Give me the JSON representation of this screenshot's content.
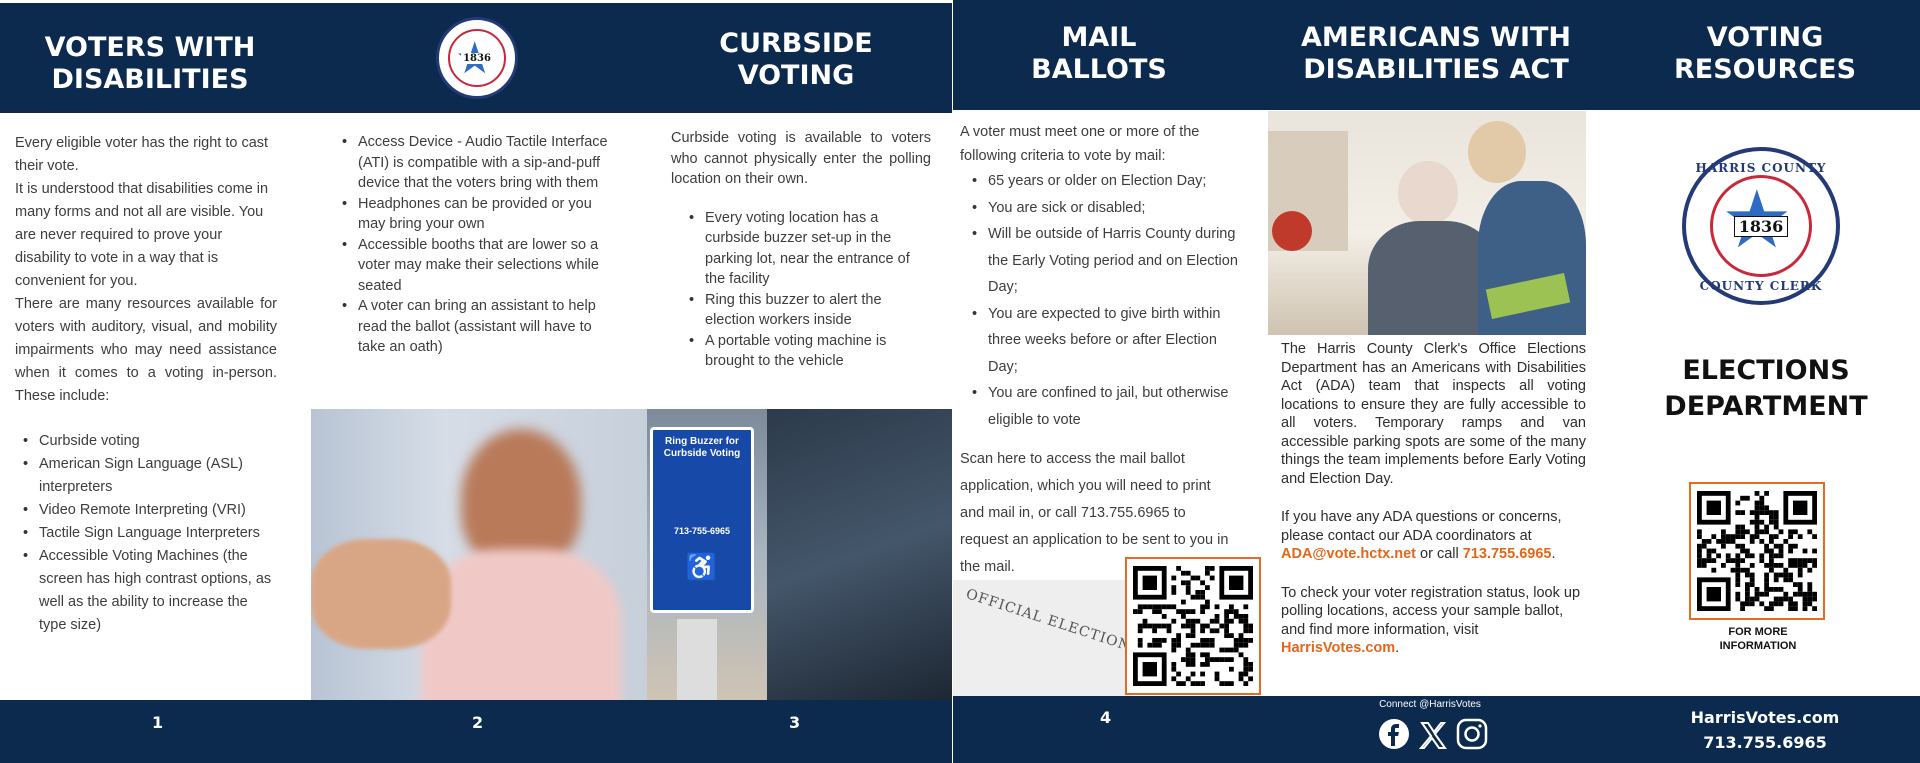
{
  "panels": {
    "voters_with_disabilities": {
      "title": "VOTERS WITH\nDISABILITIES",
      "para1": "Every eligible voter has the right to cast their vote.",
      "para2": "It is understood that disabilities come in many forms and not all are visible. You are never required to prove your disability to vote in a way that is convenient for you.",
      "para3": "There are many resources available for voters with auditory, visual, and mobility impairments who may need assistance when it comes to a voting in-person. These include:",
      "items": [
        "Curbside voting",
        "American Sign Language (ASL) interpreters",
        "Video Remote Interpreting (VRI)",
        "Tactile Sign Language Interpreters",
        "Accessible Voting Machines (the screen has high contrast options, as well as the ability to increase the type size)"
      ],
      "page": "1"
    },
    "accessibility_devices": {
      "seal_top": "HARRIS COUNTY",
      "seal_year": "1836",
      "seal_bottom": "COUNTY CLERK",
      "items": [
        "Access Device - Audio Tactile Interface (ATI) is compatible with a sip-and-puff device that the voters bring with them",
        "Headphones can be provided or you may bring your own",
        "Accessible booths that are lower so a voter may make their selections while seated",
        "A voter can bring an assistant to help read the ballot (assistant will have to take an oath)"
      ],
      "page": "2"
    },
    "curbside_voting": {
      "title": "CURBSIDE\nVOTING",
      "intro": "Curbside voting is available to voters who cannot physically enter the polling location on their own.",
      "items": [
        "Every voting location has a curbside buzzer set-up in the parking lot, near the entrance of the facility",
        "Ring this buzzer to alert the election workers inside",
        "A portable voting machine is brought to the vehicle"
      ],
      "sign_title": "Ring Buzzer for Curbside Voting",
      "sign_phone": "713-755-6965",
      "page": "3"
    },
    "mail_ballots": {
      "title": "MAIL\nBALLOTS",
      "intro": "A voter must meet one or more of the following criteria to vote by mail:",
      "items": [
        "65 years or older on Election Day;",
        "You are sick or disabled;",
        "Will be outside of Harris County during the Early Voting period and on Election Day;",
        "You are expected to give birth within three weeks before or after Election Day;",
        "You are confined to jail, but otherwise eligible to vote"
      ],
      "scan_text": "Scan here to access the mail ballot application, which you will need to print and mail in, or call 713.755.6965 to request an application to be sent to you in the mail.",
      "envelope_text": "OFFICIAL ELECTION MAIL",
      "page": "4"
    },
    "ada": {
      "title": "AMERICANS WITH\nDISABILITIES ACT",
      "para1": "The Harris County Clerk's Office Elections Department has an Americans with Disabilities Act (ADA) team that inspects all voting locations to ensure they are fully accessible to all voters. Temporary ramps and van accessible parking spots are some of the many things the team implements before Early Voting and Election Day.",
      "para2_a": "If you have any ADA questions or concerns, please contact our ADA coordinators at ",
      "para2_email": "ADA@vote.hctx.net",
      "para2_b": " or call ",
      "para2_phone": "713.755.6965",
      "para2_c": ".",
      "para3_a": "To check your voter registration status, look up polling locations, access your sample ballot, and find more information, visit ",
      "para3_link": "HarrisVotes.com",
      "para3_c": ".",
      "connect": "Connect @HarrisVotes",
      "social_icons": [
        "facebook-icon",
        "x-icon",
        "instagram-icon"
      ]
    },
    "voting_resources": {
      "title": "VOTING\nRESOURCES",
      "seal_top": "HARRIS COUNTY",
      "seal_year": "1836",
      "seal_bottom": "COUNTY CLERK",
      "dept": "ELECTIONS\nDEPARTMENT",
      "qr_caption": "FOR MORE\nINFORMATION",
      "footer_site": "HarrisVotes.com",
      "footer_phone": "713.755.6965"
    }
  },
  "colors": {
    "navy": "#0c2a4d",
    "orange": "#e2671d",
    "seal_blue": "#233a77",
    "seal_red": "#c8283a"
  }
}
